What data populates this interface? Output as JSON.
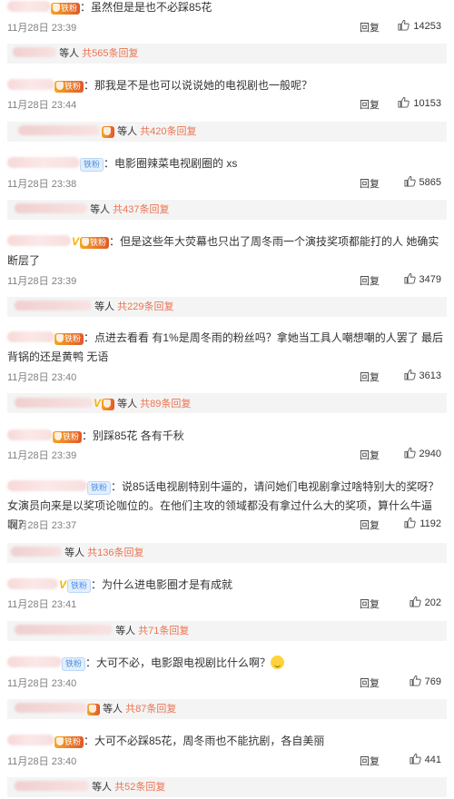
{
  "fan_badge_label": "铁粉",
  "iron_badge_label": "铁粉",
  "reply_label": "回复",
  "comments": [
    {
      "text": "：虽然但是是也不必踩85花",
      "time": "11月28日 23:39",
      "likes": "14253",
      "sub_prefix": "等人",
      "sub_count": "共565条回复"
    },
    {
      "text": "：那我是不是也可以说说她的电视剧也一般呢？",
      "time": "11月28日 23:44",
      "likes": "10153",
      "sub_prefix": "等人",
      "sub_count": "共420条回复"
    },
    {
      "text": "：电影圈辣菜电视剧圈的 xs",
      "time": "11月28日 23:38",
      "likes": "5865",
      "sub_prefix": "等人",
      "sub_count": "共437条回复"
    },
    {
      "text": "：但是这些年大荧幕也只出了周冬雨一个演技奖项都能打的人 她确实断层了",
      "time": "11月28日 23:39",
      "likes": "3479",
      "sub_prefix": "等人",
      "sub_count": "共229条回复"
    },
    {
      "text": "：点进去看看 有1%是周冬雨的粉丝吗？拿她当工具人嘲想嘲的人罢了 最后背锅的还是黄鸭 无语",
      "time": "11月28日 23:40",
      "likes": "3613",
      "sub_prefix": "等人",
      "sub_count": "共89条回复"
    },
    {
      "text": "：别踩85花 各有千秋",
      "time": "11月28日 23:39",
      "likes": "2940",
      "sub_prefix": "",
      "sub_count": ""
    },
    {
      "text": "：说85话电视剧特别牛逼的，请问她们电视剧拿过啥特别大的奖呀？女演员向来是以奖项论咖位的。在他们主攻的领域都没有拿过什么大的奖项，算什么牛逼啊？",
      "time": "11月28日 23:37",
      "likes": "1192",
      "sub_prefix": "等人",
      "sub_count": "共136条回复"
    },
    {
      "text": "：为什么进电影圈才是有成就",
      "time": "11月28日 23:41",
      "likes": "202",
      "sub_prefix": "等人",
      "sub_count": "共71条回复"
    },
    {
      "text": "：大可不必，电影跟电视剧比什么啊？",
      "time": "11月28日 23:40",
      "likes": "769",
      "sub_prefix": "等人",
      "sub_count": "共87条回复"
    },
    {
      "text": "：大可不必踩85花，周冬雨也不能抗剧，各自美丽",
      "time": "11月28日 23:40",
      "likes": "441",
      "sub_prefix": "等人",
      "sub_count": "共52条回复"
    }
  ]
}
